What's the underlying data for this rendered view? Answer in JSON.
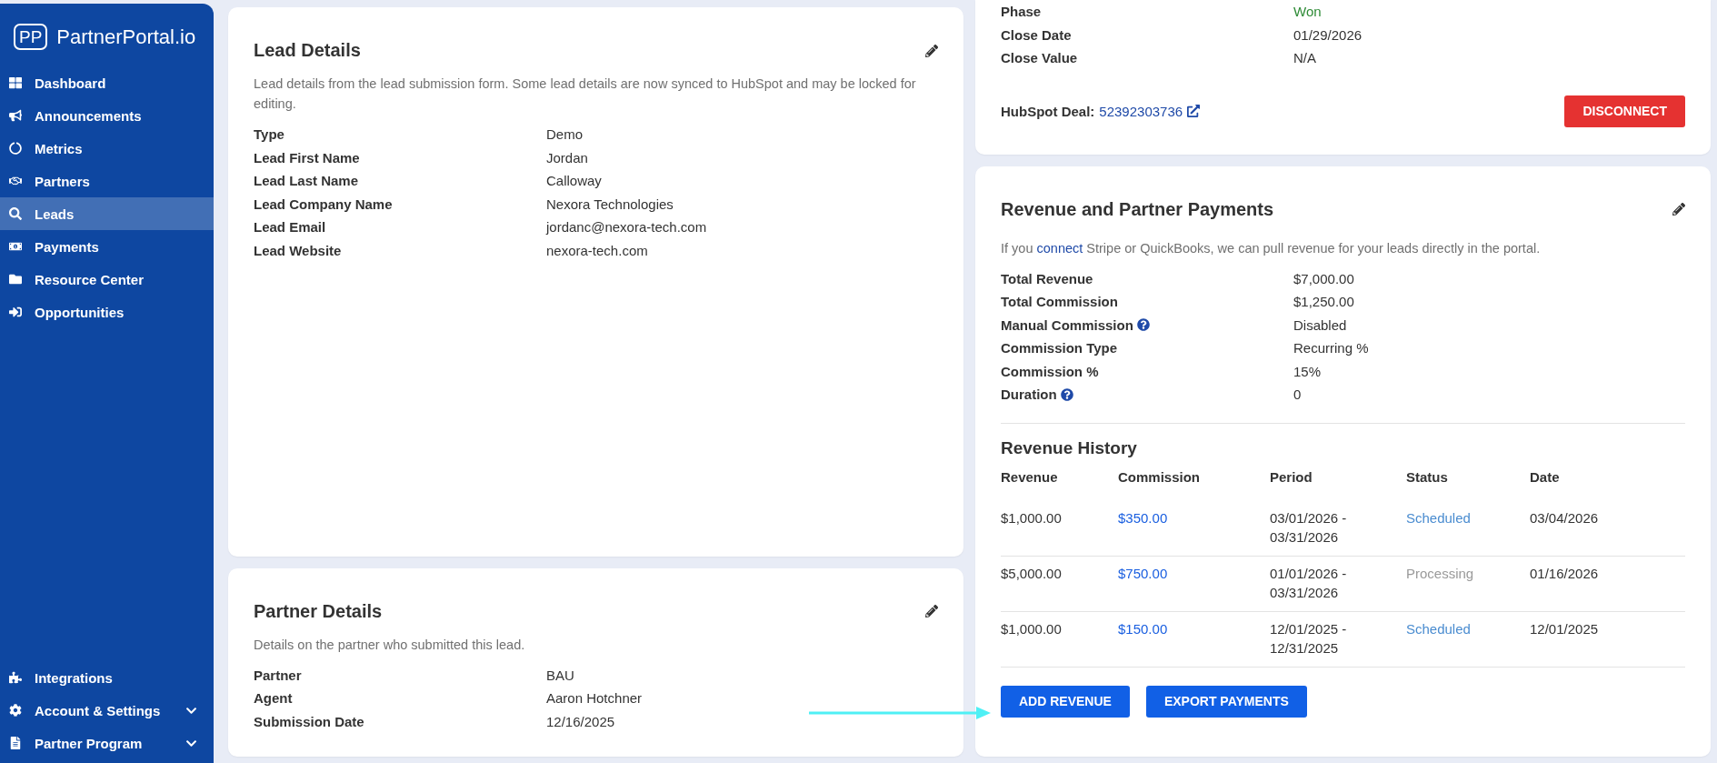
{
  "sidebar": {
    "logo_mark": "PP",
    "logo_text": "PartnerPortal.io",
    "items": [
      {
        "label": "Dashboard",
        "selected": false
      },
      {
        "label": "Announcements",
        "selected": false
      },
      {
        "label": "Metrics",
        "selected": false
      },
      {
        "label": "Partners",
        "selected": false
      },
      {
        "label": "Leads",
        "selected": true
      },
      {
        "label": "Payments",
        "selected": false
      },
      {
        "label": "Resource Center",
        "selected": false
      },
      {
        "label": "Opportunities",
        "selected": false
      }
    ],
    "bottom_items": [
      {
        "label": "Integrations",
        "kind": "link"
      },
      {
        "label": "Account & Settings",
        "kind": "group",
        "expanded": false
      },
      {
        "label": "Partner Program",
        "kind": "group",
        "expanded": false
      }
    ]
  },
  "lead_details": {
    "title": "Lead Details",
    "description": "Lead details from the lead submission form. Some lead details are now synced to HubSpot and may be locked for editing.",
    "rows": [
      {
        "label": "Type",
        "value": "Demo"
      },
      {
        "label": "Lead First Name",
        "value": "Jordan"
      },
      {
        "label": "Lead Last Name",
        "value": "Calloway"
      },
      {
        "label": "Lead Company Name",
        "value": "Nexora Technologies"
      },
      {
        "label": "Lead Email",
        "value": "jordanc@nexora-tech.com"
      },
      {
        "label": "Lead Website",
        "value": "nexora-tech.com"
      }
    ]
  },
  "partner_details": {
    "title": "Partner Details",
    "description": "Details on the partner who submitted this lead.",
    "rows": [
      {
        "label": "Partner",
        "value": "BAU"
      },
      {
        "label": "Agent",
        "value": "Aaron Hotchner"
      },
      {
        "label": "Submission Date",
        "value": "12/16/2025"
      }
    ]
  },
  "deal": {
    "rows": [
      {
        "label": "Phase",
        "value": "Won",
        "color": "#2e8b36"
      },
      {
        "label": "Close Date",
        "value": "01/29/2026",
        "color": "#333333"
      },
      {
        "label": "Close Value",
        "value": "N/A",
        "color": "#333333"
      }
    ],
    "hubspot_label": "HubSpot Deal:",
    "hubspot_id": "52392303736",
    "disconnect_button": "DISCONNECT"
  },
  "revenue": {
    "title": "Revenue and Partner Payments",
    "description_before": "If you ",
    "description_link": "connect",
    "description_after": " Stripe or QuickBooks, we can pull revenue for your leads directly in the portal.",
    "rows": [
      {
        "label": "Total Revenue",
        "value": "$7,000.00",
        "help": false
      },
      {
        "label": "Total Commission",
        "value": "$1,250.00",
        "help": false
      },
      {
        "label": "Manual Commission",
        "value": "Disabled",
        "help": true
      },
      {
        "label": "Commission Type",
        "value": "Recurring %",
        "help": false
      },
      {
        "label": "Commission %",
        "value": "15%",
        "help": false
      },
      {
        "label": "Duration",
        "value": "0",
        "help": true
      }
    ],
    "history_title": "Revenue History",
    "columns": [
      "Revenue",
      "Commission",
      "Period",
      "Status",
      "Date"
    ],
    "history": [
      {
        "revenue": "$1,000.00",
        "commission": "$350.00",
        "period_start": "03/01/2026 -",
        "period_end": "03/31/2026",
        "status": {
          "text": "Scheduled",
          "color": "#4a8cd0"
        },
        "date": "03/04/2026"
      },
      {
        "revenue": "$5,000.00",
        "commission": "$750.00",
        "period_start": "01/01/2026 -",
        "period_end": "03/31/2026",
        "status": {
          "text": "Processing",
          "color": "#9a9a9a"
        },
        "date": "01/16/2026"
      },
      {
        "revenue": "$1,000.00",
        "commission": "$150.00",
        "period_start": "12/01/2025 -",
        "period_end": "12/31/2025",
        "status": {
          "text": "Scheduled",
          "color": "#4a8cd0"
        },
        "date": "12/01/2025"
      }
    ],
    "buttons": [
      "ADD REVENUE",
      "EXPORT PAYMENTS"
    ]
  }
}
